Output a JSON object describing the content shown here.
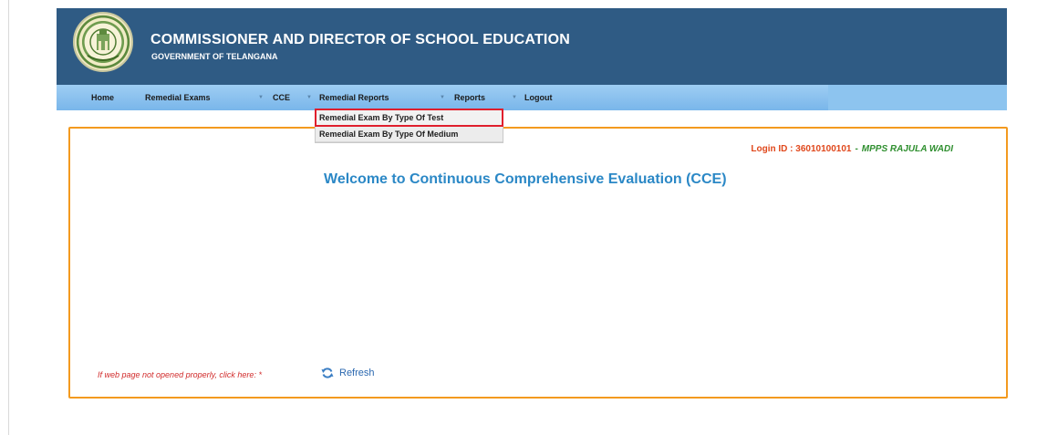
{
  "header": {
    "title": "COMMISSIONER AND DIRECTOR OF SCHOOL EDUCATION",
    "subtitle": "GOVERNMENT OF TELANGANA",
    "logo_icon": "telangana-seal-icon"
  },
  "nav": {
    "items": [
      {
        "label": "Home"
      },
      {
        "label": "Remedial Exams"
      },
      {
        "label": "CCE"
      },
      {
        "label": "Remedial Reports"
      },
      {
        "label": "Reports"
      },
      {
        "label": "Logout"
      }
    ],
    "caret_icon": "chevron-down-icon"
  },
  "dropdown": {
    "items": [
      {
        "label": "Remedial Exam By Type Of Test",
        "highlighted": true
      },
      {
        "label": "Remedial Exam By Type Of Medium",
        "highlighted": false
      }
    ]
  },
  "main": {
    "login_label": "Login ID : 36010100101",
    "separator": "-",
    "school_name": "MPPS RAJULA WADI",
    "welcome": "Welcome to Continuous Comprehensive Evaluation (CCE)",
    "note": "If web page not opened properly, click here: *",
    "refresh_label": "Refresh",
    "refresh_icon": "refresh-icon"
  },
  "colors": {
    "header_bg": "#2f5b84",
    "nav_bg": "#8dc4ef",
    "border_orange": "#f39a1f",
    "welcome_blue": "#2b88c6",
    "highlight_red": "#e01f2d"
  }
}
